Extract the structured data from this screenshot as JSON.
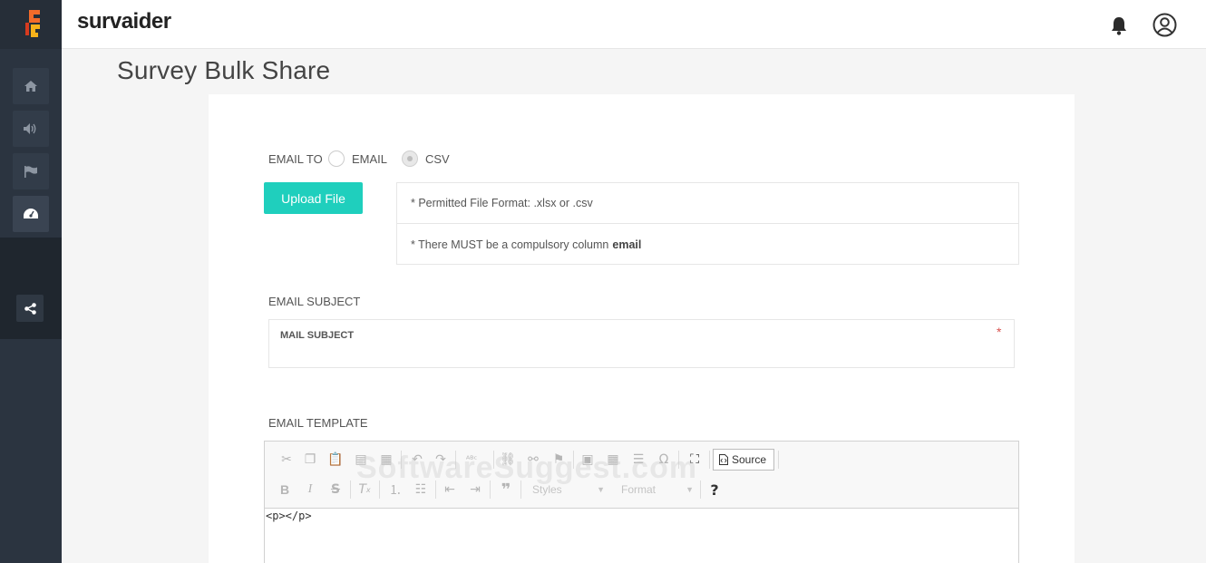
{
  "app": {
    "brand": "survaider"
  },
  "page": {
    "title": "Survey Bulk Share"
  },
  "sidebar": {
    "items": [
      {
        "name": "home",
        "icon": "home-icon"
      },
      {
        "name": "announce",
        "icon": "speaker-icon"
      },
      {
        "name": "flag",
        "icon": "flag-icon"
      },
      {
        "name": "dashboard",
        "icon": "dashboard-icon"
      }
    ],
    "share_icon": "share-icon"
  },
  "form": {
    "email_to_label": "EMAIL TO",
    "radio_email_label": "EMAIL",
    "radio_csv_label": "CSV",
    "selected": "CSV",
    "upload_label": "Upload File",
    "info_line1": "* Permitted File Format: .xlsx or .csv",
    "info_line2_prefix": "* There MUST be a compulsory column",
    "info_line2_bold": "email",
    "subject_section_label": "EMAIL SUBJECT",
    "subject_field_label": "MAIL SUBJECT",
    "required_mark": "*",
    "template_section_label": "EMAIL TEMPLATE"
  },
  "editor": {
    "source_label": "Source",
    "styles_label": "Styles",
    "format_label": "Format",
    "help_label": "?",
    "content": "<p></p>"
  },
  "watermark": "SoftwareSuggest.com",
  "colors": {
    "accent": "#1fcfbd",
    "sidebar": "#2b3440",
    "required": "#d9534f"
  }
}
